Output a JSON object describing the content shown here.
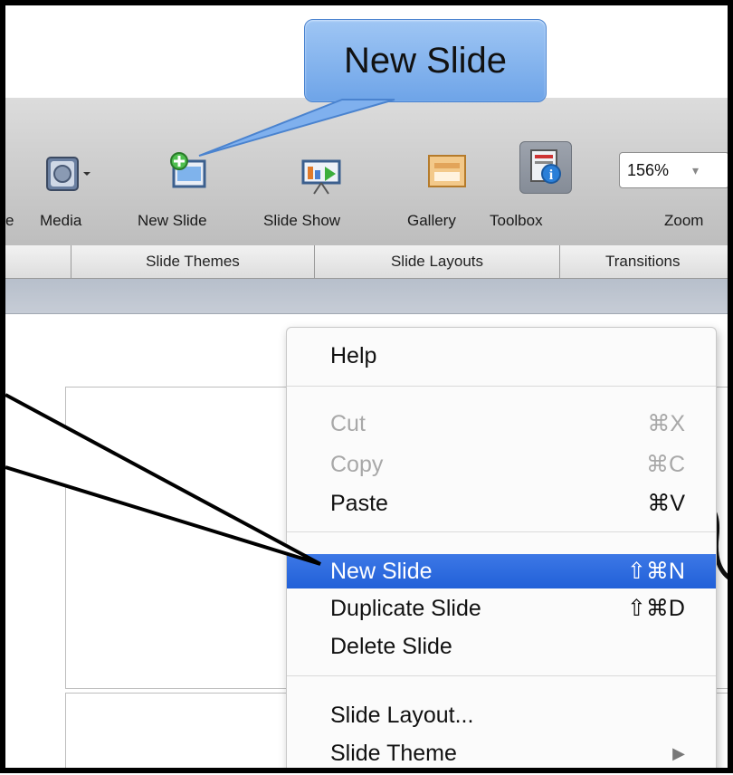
{
  "callout": {
    "text": "New Slide"
  },
  "toolbar": {
    "items": [
      {
        "label": "e"
      },
      {
        "label": "Media"
      },
      {
        "label": "New Slide"
      },
      {
        "label": "Slide Show"
      },
      {
        "label": "Gallery"
      },
      {
        "label": "Toolbox"
      },
      {
        "label": "Zoom"
      }
    ],
    "zoom_value": "156%"
  },
  "ribbon": {
    "tabs": [
      {
        "label": "Slide Themes"
      },
      {
        "label": "Slide Layouts"
      },
      {
        "label": "Transitions"
      }
    ]
  },
  "context_menu": {
    "items": [
      {
        "label": "Help",
        "shortcut": "",
        "state": "normal"
      },
      {
        "label": "Cut",
        "shortcut": "⌘X",
        "state": "disabled"
      },
      {
        "label": "Copy",
        "shortcut": "⌘C",
        "state": "disabled"
      },
      {
        "label": "Paste",
        "shortcut": "⌘V",
        "state": "normal"
      },
      {
        "label": "New Slide",
        "shortcut": "⇧⌘N",
        "state": "highlighted"
      },
      {
        "label": "Duplicate Slide",
        "shortcut": "⇧⌘D",
        "state": "normal"
      },
      {
        "label": "Delete Slide",
        "shortcut": "",
        "state": "normal"
      },
      {
        "label": "Slide Layout...",
        "shortcut": "",
        "state": "normal"
      },
      {
        "label": "Slide Theme",
        "shortcut": "▶",
        "state": "normal"
      }
    ]
  },
  "colors": {
    "highlight": "#2d6be0",
    "callout_fill": "#8fb9f0",
    "frame": "#000000"
  }
}
